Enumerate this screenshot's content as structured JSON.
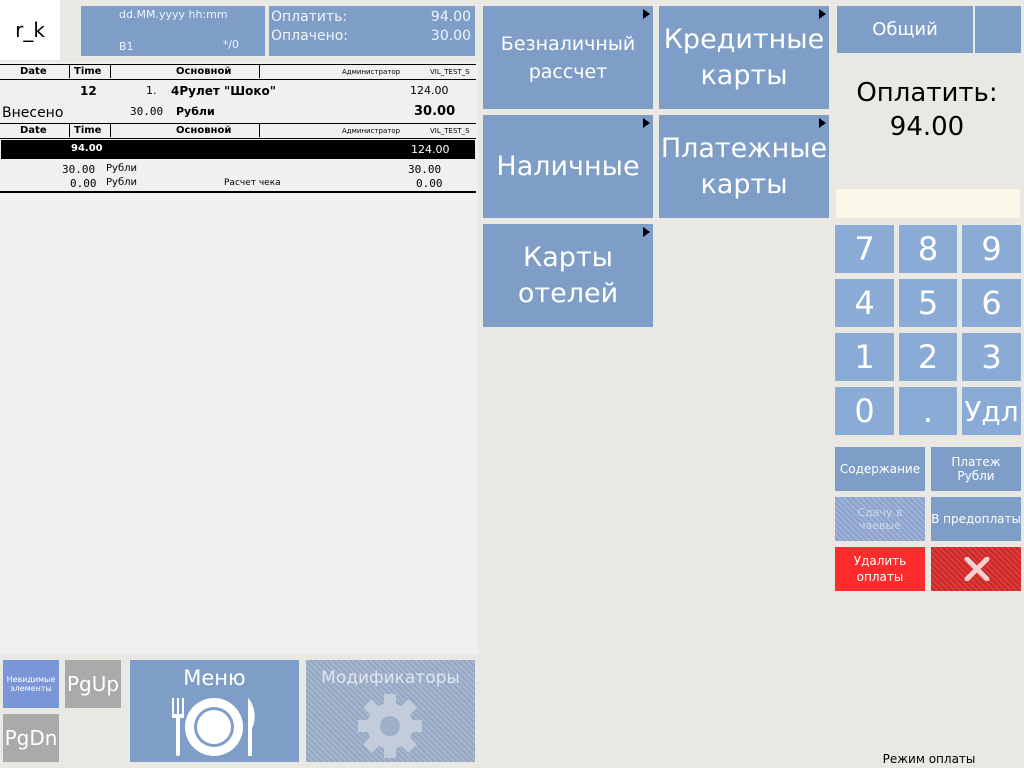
{
  "header": {
    "logo": "r_k",
    "date_format": "dd.MM.yyyy hh:mm",
    "table": "B1",
    "guests": "*/0",
    "to_pay_label": "Оплатить:",
    "to_pay_value": "94.00",
    "paid_label": "Оплачено:",
    "paid_value": "30.00"
  },
  "order": {
    "columns": {
      "date": "Date",
      "time": "Time",
      "main": "Основной",
      "admin": "Администратор",
      "station": "VIL_TEST_S"
    },
    "item": {
      "num": "12",
      "line": "1.",
      "name": "4Рулет \"Шоко\"",
      "price": "124.00"
    },
    "deposited": {
      "label": "Внесено",
      "amount": "30.00",
      "currency": "Рубли",
      "total": "30.00"
    }
  },
  "check": {
    "columns": {
      "date": "Date",
      "time": "Time",
      "main": "Основной",
      "admin": "Администратор",
      "station": "VIL_TEST_S"
    },
    "selected": {
      "amount": "94.00",
      "total": "124.00"
    },
    "payments": [
      {
        "amount": "30.00",
        "currency": "Рубли",
        "note": "",
        "value": "30.00"
      },
      {
        "amount": "0.00",
        "currency": "Рубли",
        "note": "Расчет чека",
        "value": "0.00"
      }
    ]
  },
  "bottom": {
    "invisible": "Невидимые элементы",
    "pgup": "PgUp",
    "pgdn": "PgDn",
    "menu": "Меню",
    "modifiers": "Модификаторы"
  },
  "payment_types": {
    "cashless": "Безналичный рассчет",
    "credit": "Кредитные карты",
    "cash": "Наличные",
    "payment_cards": "Платежные карты",
    "hotel": "Карты отелей"
  },
  "right": {
    "tab_general": "Общий",
    "to_pay_label": "Оплатить:",
    "to_pay_value": "94.00",
    "keys": [
      "7",
      "8",
      "9",
      "4",
      "5",
      "6",
      "1",
      "2",
      "3",
      "0",
      ".",
      "Удл"
    ],
    "content": "Содержание",
    "pay_rub": "Платеж Рубли",
    "tips": "Сдачу в чаевые",
    "prepay": "В предоплаты",
    "delete_payments": "Удалить оплаты",
    "status": "Режим оплаты"
  },
  "colors": {
    "button": "#7e9ec7",
    "key": "#8aabd6",
    "danger": "#fd2b2b",
    "background": "#e9e8e2"
  }
}
